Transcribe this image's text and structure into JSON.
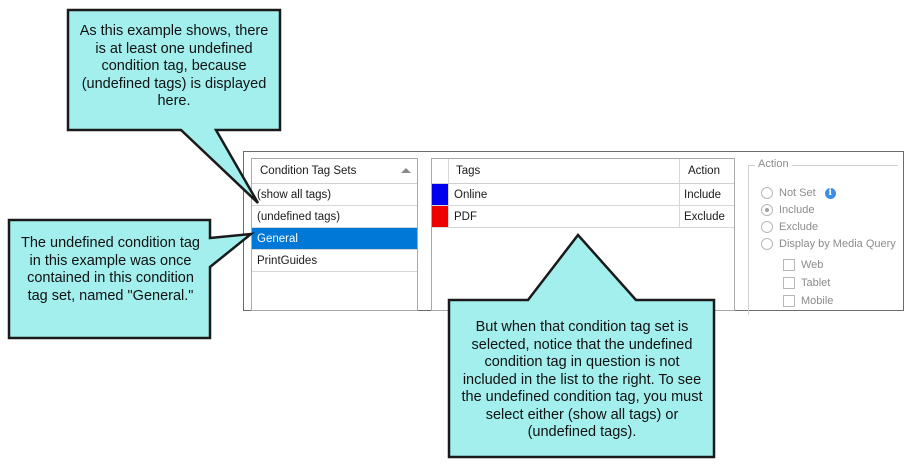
{
  "callouts": {
    "top": "As this example shows, there is at least one undefined condition tag, because (undefined tags) is displayed here.",
    "left": "The undefined condition tag in this example was once contained in this condition tag set, named \"General.\"",
    "bottom": "But when that condition tag set is selected, notice that the undefined condition tag in question is not included in the list to the right. To see the undefined condition tag, you must select either (show all tags) or (undefined tags)."
  },
  "tag_sets": {
    "header": "Condition Tag Sets",
    "items": [
      {
        "label": "(show all tags)",
        "selected": false
      },
      {
        "label": "(undefined tags)",
        "selected": false
      },
      {
        "label": "General",
        "selected": true
      },
      {
        "label": "PrintGuides",
        "selected": false
      }
    ]
  },
  "tags": {
    "headers": {
      "tags": "Tags",
      "action": "Action"
    },
    "rows": [
      {
        "name": "Online",
        "action": "Include",
        "color": "#0000ee"
      },
      {
        "name": "PDF",
        "action": "Exclude",
        "color": "#ee0000"
      }
    ]
  },
  "action": {
    "legend": "Action",
    "radios": [
      {
        "label": "Not Set",
        "checked": false
      },
      {
        "label": "Include",
        "checked": true
      },
      {
        "label": "Exclude",
        "checked": false
      },
      {
        "label": "Display by Media Query",
        "checked": false
      }
    ],
    "info_icon": "i",
    "checks": [
      {
        "label": "Web"
      },
      {
        "label": "Tablet"
      },
      {
        "label": "Mobile"
      }
    ]
  },
  "colors": {
    "callout_fill": "#a3efee",
    "selection": "#0078d7"
  }
}
